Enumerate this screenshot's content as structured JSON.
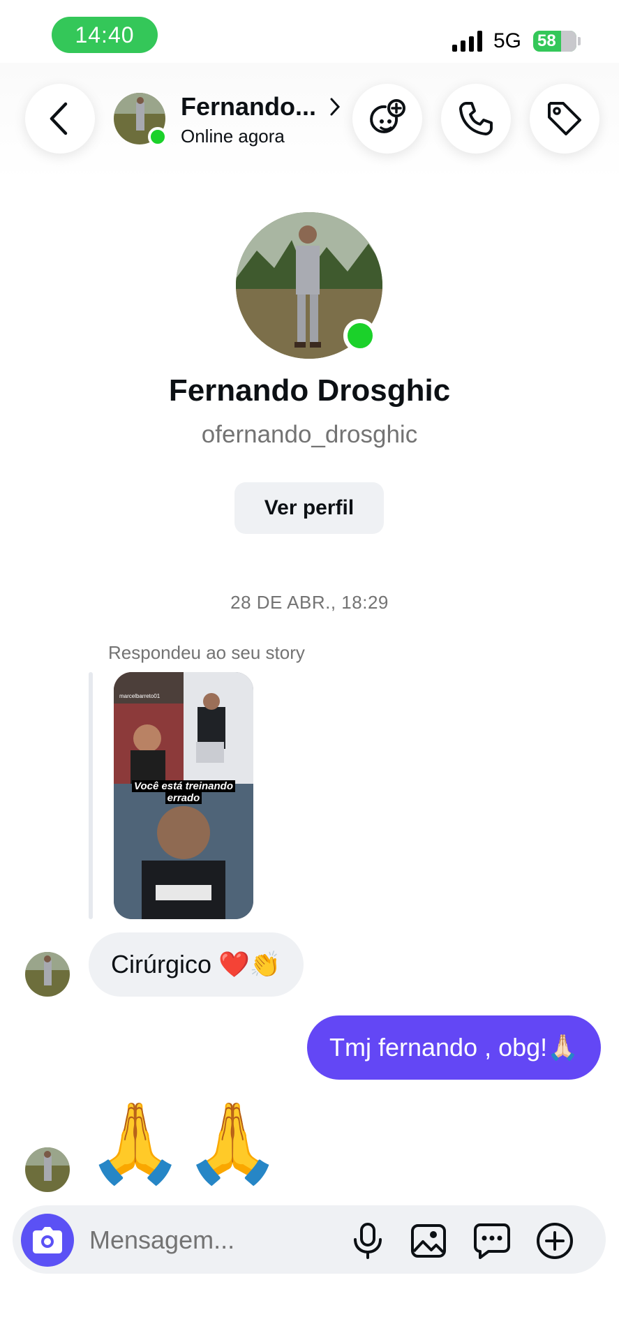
{
  "status_bar": {
    "time": "14:40",
    "network": "5G",
    "battery": "58"
  },
  "header": {
    "name": "Fernando...",
    "status": "Online agora"
  },
  "profile": {
    "full_name": "Fernando Drosghic",
    "username": "ofernando_drosghic",
    "view_profile_label": "Ver perfil"
  },
  "chat": {
    "timestamp": "28 DE ABR., 18:29",
    "reply_label": "Respondeu ao seu story",
    "story_caption_line1": "Você está treinando",
    "story_caption_line2": "errado",
    "story_corner_text": "marcelbarreto01",
    "messages": [
      {
        "from": "them",
        "text": "Cirúrgico ❤️👏"
      },
      {
        "from": "me",
        "text": "Tmj fernando , obg!🙏🏻"
      },
      {
        "from": "them",
        "text": "🙏🙏"
      }
    ]
  },
  "composer": {
    "placeholder": "Mensagem..."
  },
  "colors": {
    "accent": "#6347f5",
    "camera": "#5b51f5",
    "online": "#1bd12a",
    "status_pill": "#34c759"
  }
}
